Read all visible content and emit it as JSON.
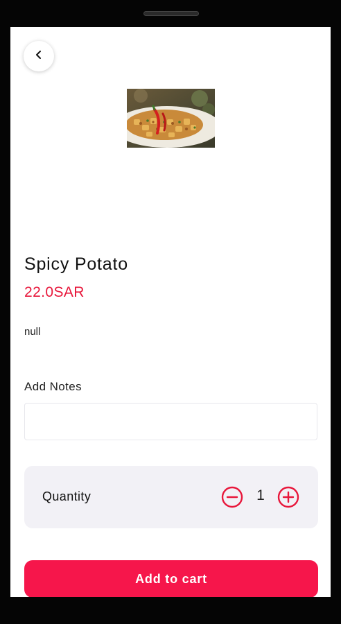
{
  "product": {
    "name": "Spicy Potato",
    "price": "22.0SAR",
    "description": "null"
  },
  "notes": {
    "label": "Add Notes",
    "value": "",
    "placeholder": ""
  },
  "quantity": {
    "label": "Quantity",
    "value": "1"
  },
  "actions": {
    "add_to_cart": "Add to cart"
  },
  "icons": {
    "back": "chevron-left-icon",
    "decrease": "minus-circle-icon",
    "increase": "plus-circle-icon"
  },
  "colors": {
    "accent": "#e8173b",
    "button": "#f6164b",
    "card": "#f2f1f6"
  }
}
